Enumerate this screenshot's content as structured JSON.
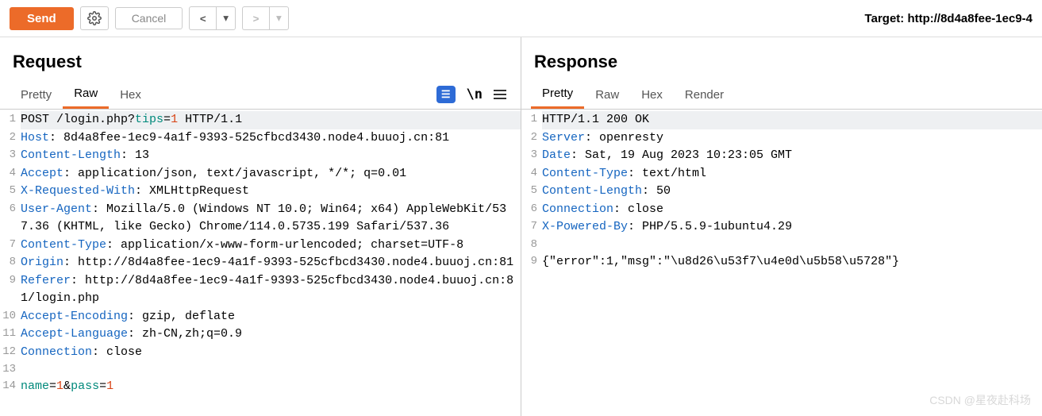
{
  "toolbar": {
    "send": "Send",
    "cancel": "Cancel"
  },
  "target_label": "Target: http://8d4a8fee-1ec9-4",
  "request": {
    "title": "Request",
    "tabs": {
      "pretty": "Pretty",
      "raw": "Raw",
      "hex": "Hex"
    },
    "tool_n": "\\n",
    "lines": [
      {
        "n": "1",
        "hl": true,
        "segs": [
          [
            "",
            "POST /login.php?"
          ],
          [
            "hq",
            "tips"
          ],
          [
            "",
            "="
          ],
          [
            "hv",
            "1"
          ],
          [
            "",
            " HTTP/1.1"
          ]
        ]
      },
      {
        "n": "2",
        "segs": [
          [
            "hk",
            "Host"
          ],
          [
            "",
            ": 8d4a8fee-1ec9-4a1f-9393-525cfbcd3430.node4.buuoj.cn:81"
          ]
        ]
      },
      {
        "n": "3",
        "segs": [
          [
            "hk",
            "Content-Length"
          ],
          [
            "",
            ": 13"
          ]
        ]
      },
      {
        "n": "4",
        "segs": [
          [
            "hk",
            "Accept"
          ],
          [
            "",
            ": application/json, text/javascript, */*; q=0.01"
          ]
        ]
      },
      {
        "n": "5",
        "segs": [
          [
            "hk",
            "X-Requested-With"
          ],
          [
            "",
            ": XMLHttpRequest"
          ]
        ]
      },
      {
        "n": "6",
        "segs": [
          [
            "hk",
            "User-Agent"
          ],
          [
            "",
            ": Mozilla/5.0 (Windows NT 10.0; Win64; x64) AppleWebKit/537.36 (KHTML, like Gecko) Chrome/114.0.5735.199 Safari/537.36"
          ]
        ]
      },
      {
        "n": "7",
        "segs": [
          [
            "hk",
            "Content-Type"
          ],
          [
            "",
            ": application/x-www-form-urlencoded; charset=UTF-8"
          ]
        ]
      },
      {
        "n": "8",
        "segs": [
          [
            "hk",
            "Origin"
          ],
          [
            "",
            ": http://8d4a8fee-1ec9-4a1f-9393-525cfbcd3430.node4.buuoj.cn:81"
          ]
        ]
      },
      {
        "n": "9",
        "segs": [
          [
            "hk",
            "Referer"
          ],
          [
            "",
            ": http://8d4a8fee-1ec9-4a1f-9393-525cfbcd3430.node4.buuoj.cn:81/login.php"
          ]
        ]
      },
      {
        "n": "10",
        "segs": [
          [
            "hk",
            "Accept-Encoding"
          ],
          [
            "",
            ": gzip, deflate"
          ]
        ]
      },
      {
        "n": "11",
        "segs": [
          [
            "hk",
            "Accept-Language"
          ],
          [
            "",
            ": zh-CN,zh;q=0.9"
          ]
        ]
      },
      {
        "n": "12",
        "segs": [
          [
            "hk",
            "Connection"
          ],
          [
            "",
            ": close"
          ]
        ]
      },
      {
        "n": "13",
        "segs": [
          [
            "",
            ""
          ]
        ]
      },
      {
        "n": "14",
        "segs": [
          [
            "hq",
            "name"
          ],
          [
            "",
            "="
          ],
          [
            "hv",
            "1"
          ],
          [
            "",
            "&"
          ],
          [
            "hq",
            "pass"
          ],
          [
            "",
            "="
          ],
          [
            "hv",
            "1"
          ]
        ]
      }
    ]
  },
  "response": {
    "title": "Response",
    "tabs": {
      "pretty": "Pretty",
      "raw": "Raw",
      "hex": "Hex",
      "render": "Render"
    },
    "lines": [
      {
        "n": "1",
        "hl": true,
        "segs": [
          [
            "",
            "HTTP/1.1 200 OK"
          ]
        ]
      },
      {
        "n": "2",
        "segs": [
          [
            "hk",
            "Server"
          ],
          [
            "",
            ": openresty"
          ]
        ]
      },
      {
        "n": "3",
        "segs": [
          [
            "hk",
            "Date"
          ],
          [
            "",
            ": Sat, 19 Aug 2023 10:23:05 GMT"
          ]
        ]
      },
      {
        "n": "4",
        "segs": [
          [
            "hk",
            "Content-Type"
          ],
          [
            "",
            ": text/html"
          ]
        ]
      },
      {
        "n": "5",
        "segs": [
          [
            "hk",
            "Content-Length"
          ],
          [
            "",
            ": 50"
          ]
        ]
      },
      {
        "n": "6",
        "segs": [
          [
            "hk",
            "Connection"
          ],
          [
            "",
            ": close"
          ]
        ]
      },
      {
        "n": "7",
        "segs": [
          [
            "hk",
            "X-Powered-By"
          ],
          [
            "",
            ": PHP/5.5.9-1ubuntu4.29"
          ]
        ]
      },
      {
        "n": "8",
        "segs": [
          [
            "",
            ""
          ]
        ]
      },
      {
        "n": "9",
        "segs": [
          [
            "",
            "{\"error\":1,\"msg\":\"\\u8d26\\u53f7\\u4e0d\\u5b58\\u5728\"}"
          ]
        ]
      }
    ]
  },
  "watermark": "CSDN @星夜赴科场"
}
